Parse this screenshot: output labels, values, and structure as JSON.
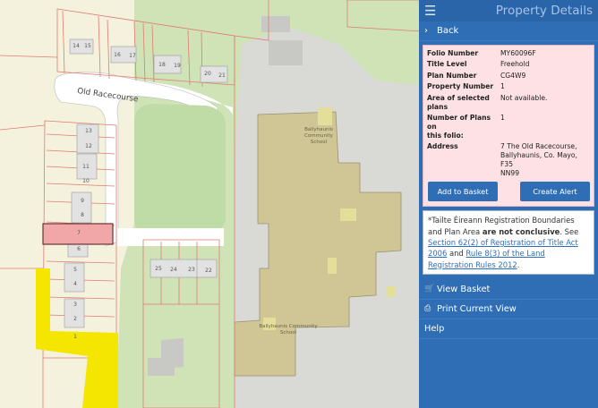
{
  "map": {
    "labels": {
      "road": "Old Racecourse",
      "school_upper_1": "Ballyhaunis",
      "school_upper_2": "Community",
      "school_upper_3": "School",
      "school_lower_1": "Ballyhaunis Community",
      "school_lower_2": "School"
    },
    "plots": {
      "p1": "1",
      "p2": "2",
      "p3": "3",
      "p4": "4",
      "p5": "5",
      "p6": "6",
      "p7": "7",
      "p8": "8",
      "p9": "9",
      "p10": "10",
      "p11": "11",
      "p12": "12",
      "p13": "13",
      "p14": "14",
      "p15": "15",
      "p16": "16",
      "p17": "17",
      "p18": "18",
      "p19": "19",
      "p20": "20",
      "p21": "21",
      "p22": "22",
      "p23": "23",
      "p24": "24",
      "p25": "25"
    }
  },
  "panel": {
    "menu_icon": "hamburger-icon",
    "title": "Property Details",
    "back": "Back",
    "details": {
      "folio_label": "Folio Number",
      "folio_value": "MY60096F",
      "title_label": "Title Level",
      "title_value": "Freehold",
      "plan_label": "Plan Number",
      "plan_value": "CG4W9",
      "prop_label": "Property Number",
      "prop_value": "1",
      "area_label_1": "Area of selected",
      "area_label_2": "plans",
      "area_value": "Not available.",
      "nplans_label_1": "Number of Plans on",
      "nplans_label_2": "this folio:",
      "nplans_value": "1",
      "address_label": "Address",
      "address_line1": "7 The Old Racecourse,",
      "address_line2": "Ballyhaunis, Co. Mayo, F35",
      "address_line3": "NN99"
    },
    "add_basket": "Add to Basket",
    "create_alert": "Create Alert",
    "note": {
      "text1": "*Tailte Éireann Registration Boundaries and Plan Area ",
      "bold": "are not conclusive",
      "text2": ". See ",
      "link1": "Section 62(2) of Registration of Title Act 2006",
      "text3": " and ",
      "link2": "Rule 8(3) of the Land Registration Rules 2012",
      "text4": "."
    },
    "view_basket": "View Basket",
    "print_view": "Print Current View",
    "help": "Help"
  }
}
